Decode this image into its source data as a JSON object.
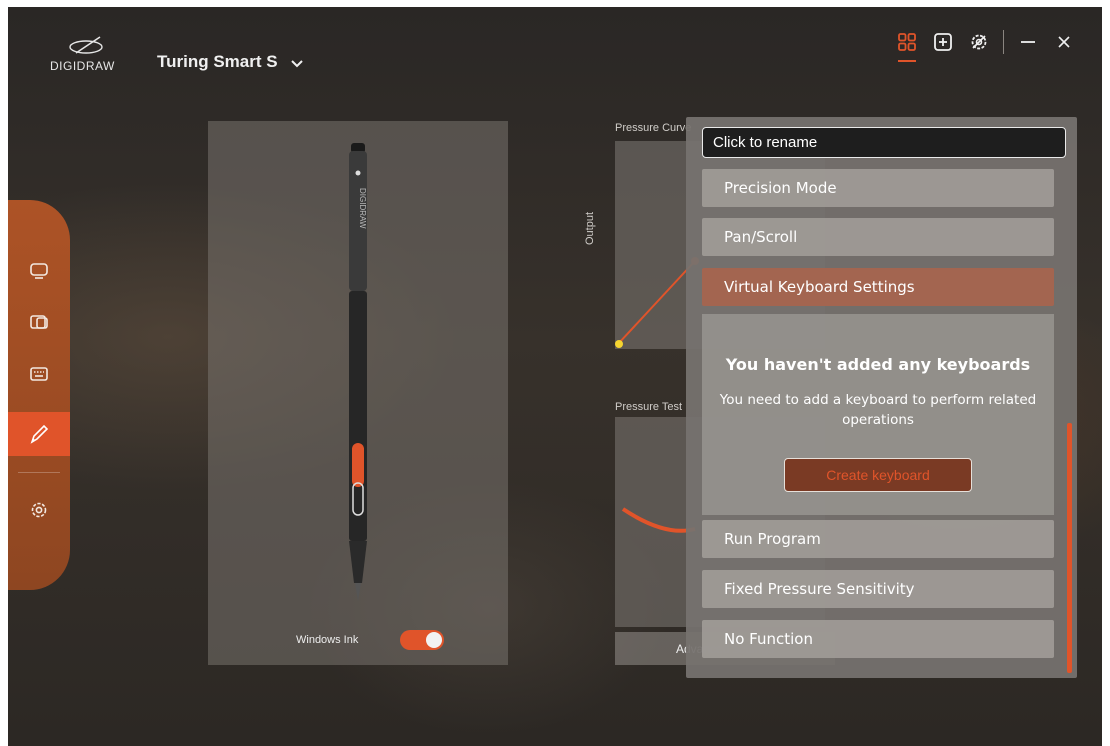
{
  "brand": {
    "logo_text": "DIGIDRAW"
  },
  "device": {
    "name": "Turing Smart S"
  },
  "top_icons": [
    "grid-icon",
    "add-icon",
    "settings-badge-icon",
    "minimize-icon",
    "close-icon"
  ],
  "sidebar": {
    "items": [
      {
        "icon": "monitor-icon"
      },
      {
        "icon": "tablet-icon"
      },
      {
        "icon": "keyboard-icon"
      },
      {
        "icon": "pen-icon",
        "active": true
      },
      {
        "icon": "gear-icon"
      }
    ]
  },
  "pen_panel": {
    "pen_brand": "DIGIDRAW",
    "windows_ink_label": "Windows Ink",
    "windows_ink_on": true
  },
  "pressure": {
    "curve_title": "Pressure Curve",
    "output_label": "Output",
    "test_title": "Pressure Test",
    "advanced_label": "Advanced settings"
  },
  "dropdown": {
    "rename_value": "Click to rename",
    "options_top": [
      "Precision Mode",
      "Pan/Scroll",
      "Virtual Keyboard Settings"
    ],
    "selected": "Virtual Keyboard Settings",
    "empty_title": "You haven't added any keyboards",
    "empty_desc": "You need to add a keyboard to perform related operations",
    "create_label": "Create keyboard",
    "options_bottom": [
      "Run Program",
      "Fixed Pressure Sensitivity",
      "No Function"
    ]
  },
  "colors": {
    "accent": "#e0542a",
    "sidebar": "#9c4c24",
    "panel": "#76726e"
  }
}
